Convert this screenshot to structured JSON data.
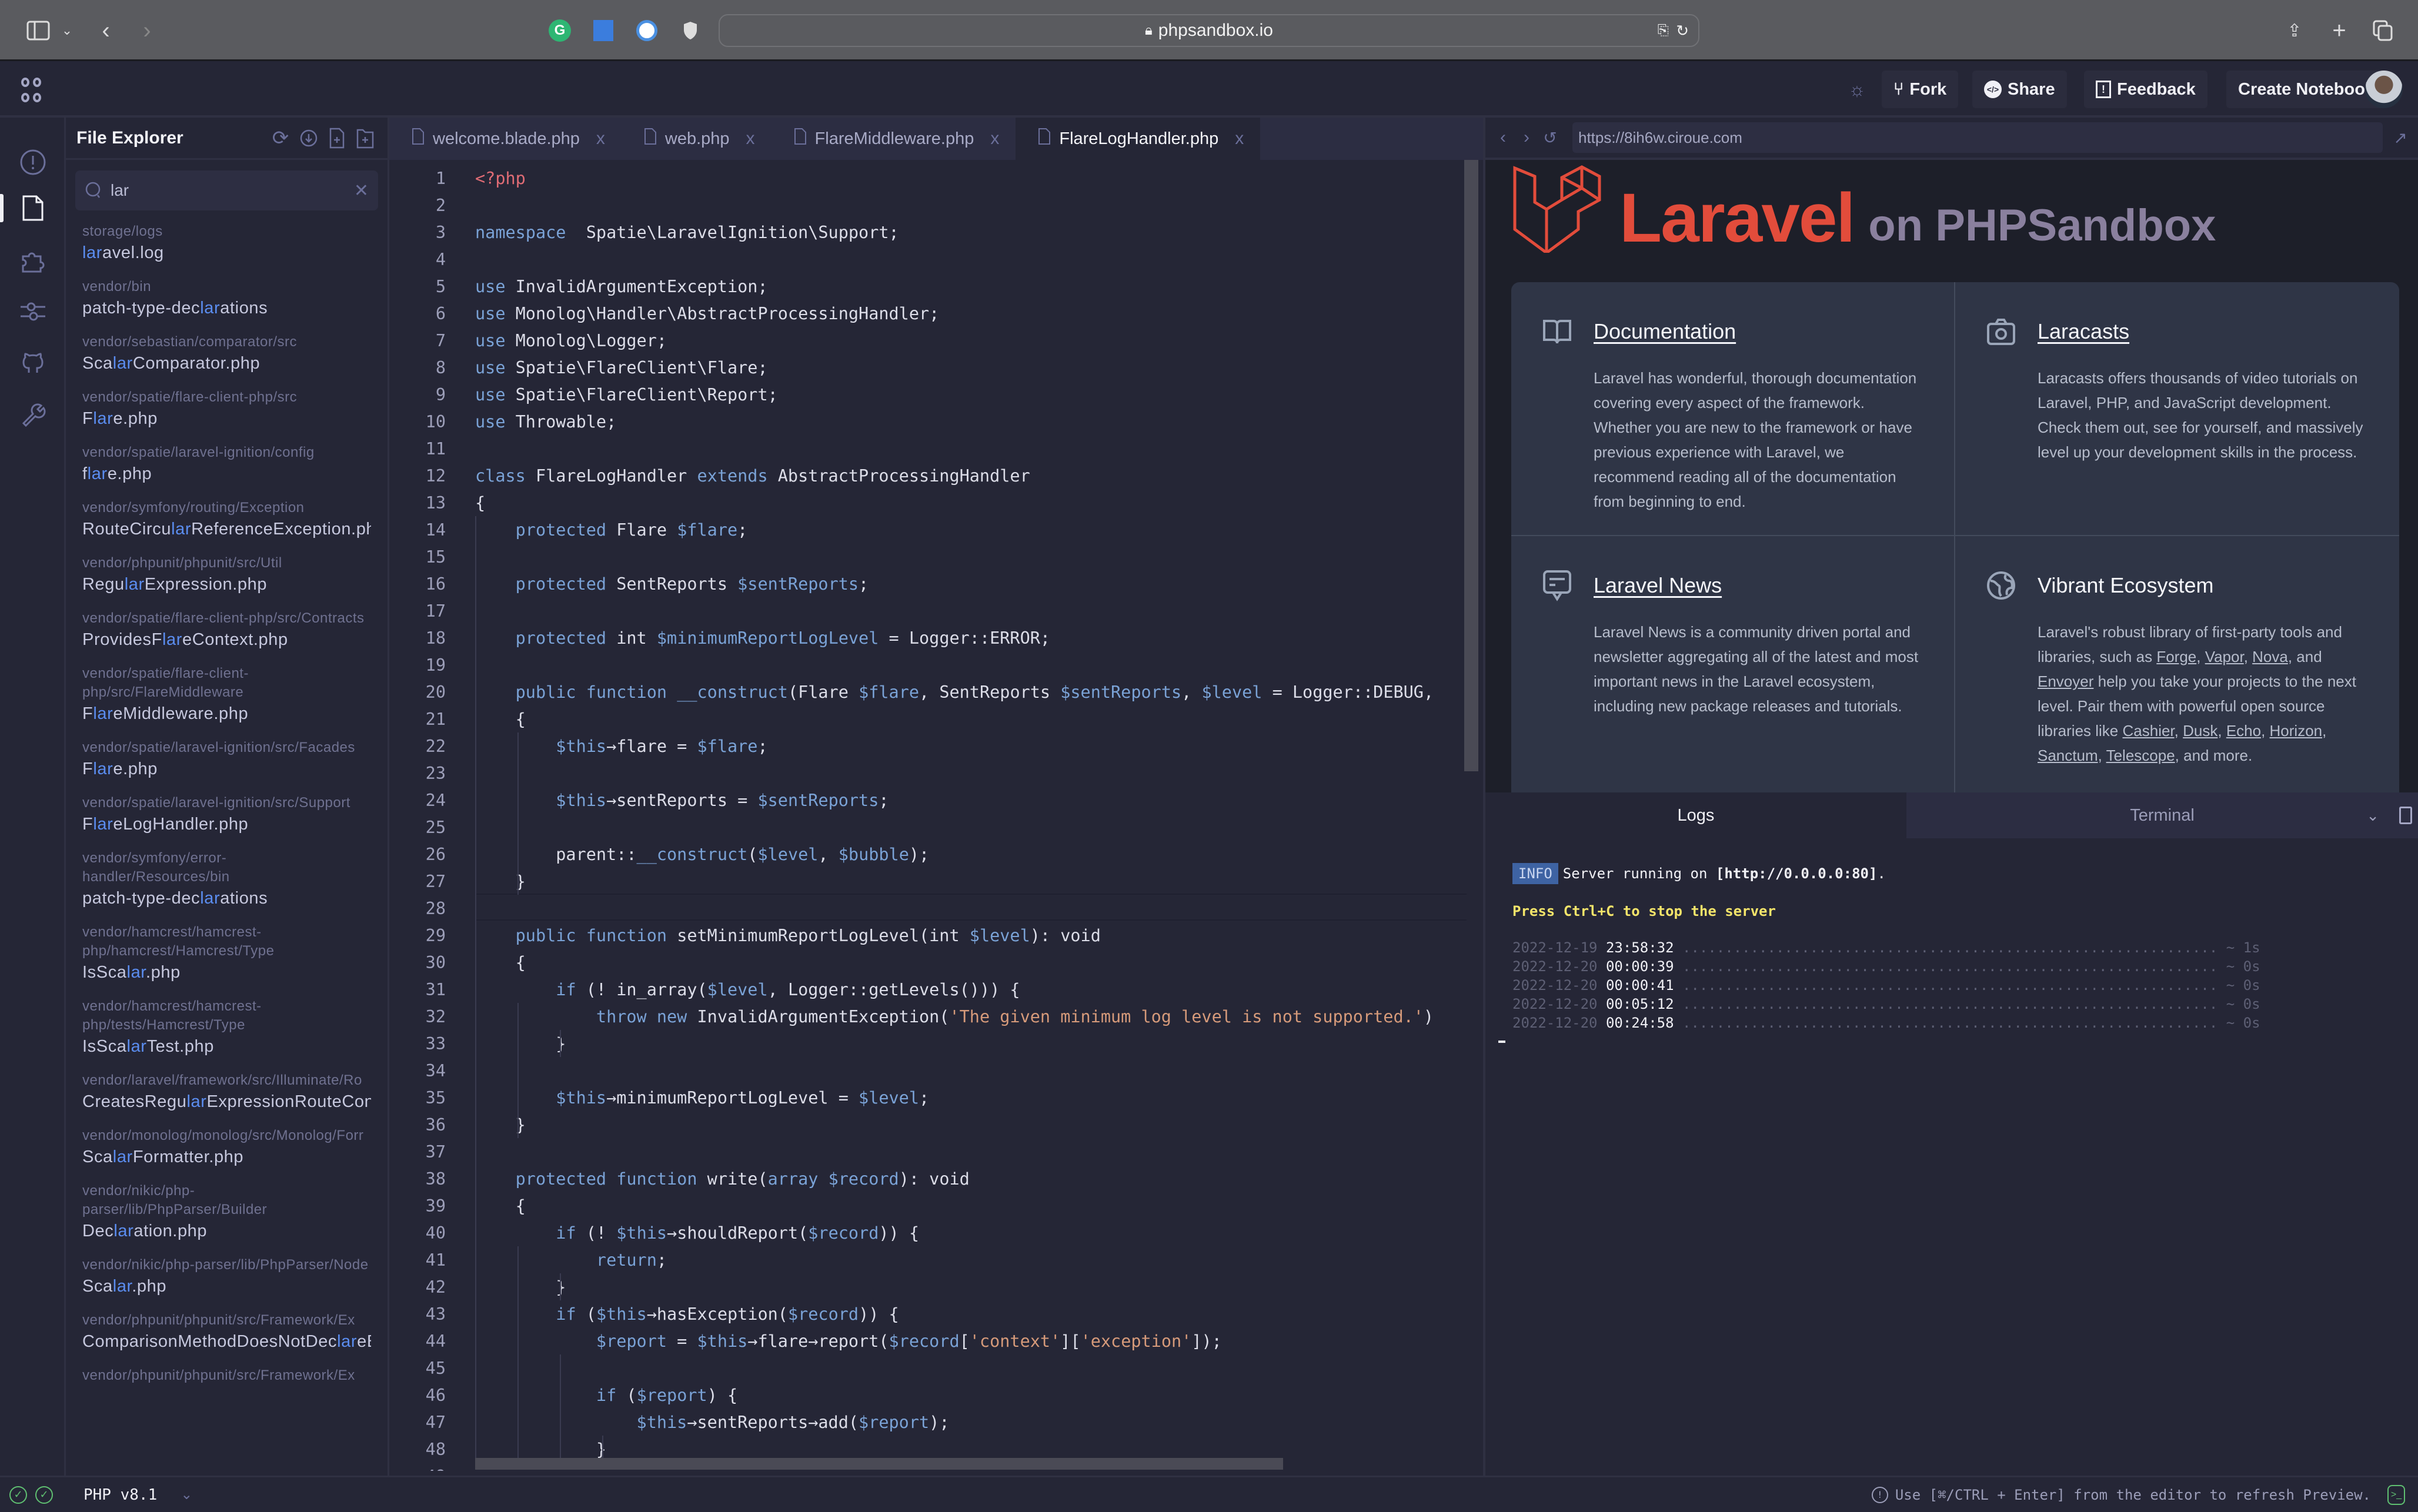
{
  "browser": {
    "url": "phpsandbox.io",
    "extensions": [
      "grammarly-icon",
      "reader-icon",
      "password-icon",
      "shield-icon"
    ]
  },
  "header": {
    "fork_label": "Fork",
    "share_label": "Share",
    "feedback_label": "Feedback",
    "create_notebook_label": "Create Notebook"
  },
  "explorer": {
    "title": "File Explorer",
    "search_value": "lar",
    "search_highlight": "lar",
    "files": [
      {
        "path": "storage/logs",
        "name": [
          "",
          "lar",
          "avel.log"
        ]
      },
      {
        "path": "vendor/bin",
        "name": [
          "patch-type-dec",
          "lar",
          "ations"
        ]
      },
      {
        "path": "vendor/sebastian/comparator/src",
        "name": [
          "Sca",
          "lar",
          "Comparator.php"
        ]
      },
      {
        "path": "vendor/spatie/flare-client-php/src",
        "name": [
          "F",
          "lar",
          "e.php"
        ]
      },
      {
        "path": "vendor/spatie/laravel-ignition/config",
        "name": [
          "f",
          "lar",
          "e.php"
        ]
      },
      {
        "path": "vendor/symfony/routing/Exception",
        "name": [
          "RouteCircu",
          "lar",
          "ReferenceException.ph"
        ]
      },
      {
        "path": "vendor/phpunit/phpunit/src/Util",
        "name": [
          "Regu",
          "lar",
          "Expression.php"
        ]
      },
      {
        "path": "vendor/spatie/flare-client-php/src/Contracts",
        "name": [
          "ProvidesF",
          "lar",
          "eContext.php"
        ]
      },
      {
        "path": "vendor/spatie/flare-client-php/src/FlareMiddleware",
        "name": [
          "F",
          "lar",
          "eMiddleware.php"
        ]
      },
      {
        "path": "vendor/spatie/laravel-ignition/src/Facades",
        "name": [
          "F",
          "lar",
          "e.php"
        ]
      },
      {
        "path": "vendor/spatie/laravel-ignition/src/Support",
        "name": [
          "F",
          "lar",
          "eLogHandler.php"
        ]
      },
      {
        "path": "vendor/symfony/error-handler/Resources/bin",
        "name": [
          "patch-type-dec",
          "lar",
          "ations"
        ]
      },
      {
        "path": "vendor/hamcrest/hamcrest-php/hamcrest/Hamcrest/Type",
        "name": [
          "IsSca",
          "lar",
          ".php"
        ]
      },
      {
        "path": "vendor/hamcrest/hamcrest-php/tests/Hamcrest/Type",
        "name": [
          "IsSca",
          "lar",
          "Test.php"
        ]
      },
      {
        "path": "vendor/laravel/framework/src/Illuminate/Ro",
        "name": [
          "CreatesRegu",
          "lar",
          "ExpressionRouteCons"
        ]
      },
      {
        "path": "vendor/monolog/monolog/src/Monolog/Forr",
        "name": [
          "Sca",
          "lar",
          "Formatter.php"
        ]
      },
      {
        "path": "vendor/nikic/php-parser/lib/PhpParser/Builder",
        "name": [
          "Dec",
          "lar",
          "ation.php"
        ]
      },
      {
        "path": "vendor/nikic/php-parser/lib/PhpParser/Node",
        "name": [
          "Sca",
          "lar",
          ".php"
        ]
      },
      {
        "path": "vendor/phpunit/phpunit/src/Framework/Ex",
        "name": [
          "ComparisonMethodDoesNotDec",
          "lar",
          "eB"
        ]
      },
      {
        "path": "vendor/phpunit/phpunit/src/Framework/Ex",
        "name": [
          "",
          "",
          ""
        ]
      }
    ]
  },
  "editor": {
    "tabs": [
      {
        "label": "welcome.blade.php",
        "active": false
      },
      {
        "label": "web.php",
        "active": false
      },
      {
        "label": "FlareMiddleware.php",
        "active": false
      },
      {
        "label": "FlareLogHandler.php",
        "active": true
      }
    ],
    "lines": [
      [
        [
          "tag",
          "<?php"
        ]
      ],
      [],
      [
        [
          "kw",
          "namespace"
        ],
        [
          "",
          "  Spatie\\LaravelIgnition\\Support;"
        ]
      ],
      [],
      [
        [
          "kw",
          "use"
        ],
        [
          "",
          " InvalidArgumentException;"
        ]
      ],
      [
        [
          "kw",
          "use"
        ],
        [
          "",
          " Monolog\\Handler\\AbstractProcessingHandler;"
        ]
      ],
      [
        [
          "kw",
          "use"
        ],
        [
          "",
          " Monolog\\Logger;"
        ]
      ],
      [
        [
          "kw",
          "use"
        ],
        [
          "",
          " Spatie\\FlareClient\\Flare;"
        ]
      ],
      [
        [
          "kw",
          "use"
        ],
        [
          "",
          " Spatie\\FlareClient\\Report;"
        ]
      ],
      [
        [
          "kw",
          "use"
        ],
        [
          "",
          " Throwable;"
        ]
      ],
      [],
      [
        [
          "kw",
          "class"
        ],
        [
          "",
          " FlareLogHandler "
        ],
        [
          "kw",
          "extends"
        ],
        [
          "",
          " AbstractProcessingHandler"
        ]
      ],
      [
        [
          "",
          "{"
        ]
      ],
      [
        [
          "",
          "    "
        ],
        [
          "kw",
          "protected"
        ],
        [
          "",
          " Flare "
        ],
        [
          "var",
          "$flare"
        ],
        [
          "",
          ";"
        ]
      ],
      [],
      [
        [
          "",
          "    "
        ],
        [
          "kw",
          "protected"
        ],
        [
          "",
          " SentReports "
        ],
        [
          "var",
          "$sentReports"
        ],
        [
          "",
          ";"
        ]
      ],
      [],
      [
        [
          "",
          "    "
        ],
        [
          "kw",
          "protected"
        ],
        [
          "",
          " int "
        ],
        [
          "var",
          "$minimumReportLogLevel"
        ],
        [
          "",
          " = Logger::ERROR;"
        ]
      ],
      [],
      [
        [
          "",
          "    "
        ],
        [
          "kw",
          "public function"
        ],
        [
          "",
          " "
        ],
        [
          "kw",
          "__construct"
        ],
        [
          "",
          "(Flare "
        ],
        [
          "var",
          "$flare"
        ],
        [
          "",
          ", SentReports "
        ],
        [
          "var",
          "$sentReports"
        ],
        [
          "",
          ", "
        ],
        [
          "var",
          "$level"
        ],
        [
          "",
          " = Logger::DEBUG,"
        ]
      ],
      [
        [
          "",
          "    {"
        ]
      ],
      [
        [
          "",
          "        "
        ],
        [
          "var",
          "$this"
        ],
        [
          "",
          "→flare = "
        ],
        [
          "var",
          "$flare"
        ],
        [
          "",
          ";"
        ]
      ],
      [],
      [
        [
          "",
          "        "
        ],
        [
          "var",
          "$this"
        ],
        [
          "",
          "→sentReports = "
        ],
        [
          "var",
          "$sentReports"
        ],
        [
          "",
          ";"
        ]
      ],
      [],
      [
        [
          "",
          "        parent::"
        ],
        [
          "kw",
          "__construct"
        ],
        [
          "",
          "("
        ],
        [
          "var",
          "$level"
        ],
        [
          "",
          ", "
        ],
        [
          "var",
          "$bubble"
        ],
        [
          "",
          ");"
        ]
      ],
      [
        [
          "",
          "    }"
        ]
      ],
      [],
      [
        [
          "",
          "    "
        ],
        [
          "kw",
          "public function"
        ],
        [
          "",
          " setMinimumReportLogLevel(int "
        ],
        [
          "var",
          "$level"
        ],
        [
          "",
          "): void"
        ]
      ],
      [
        [
          "",
          "    {"
        ]
      ],
      [
        [
          "",
          "        "
        ],
        [
          "kw",
          "if"
        ],
        [
          "",
          " (! in_array("
        ],
        [
          "var",
          "$level"
        ],
        [
          "",
          ", Logger::getLevels())) {"
        ]
      ],
      [
        [
          "",
          "            "
        ],
        [
          "kw",
          "throw new"
        ],
        [
          "",
          " InvalidArgumentException("
        ],
        [
          "str",
          "'The given minimum log level is not supported.'"
        ],
        [
          "",
          ")"
        ]
      ],
      [
        [
          "",
          "        }"
        ]
      ],
      [],
      [
        [
          "",
          "        "
        ],
        [
          "var",
          "$this"
        ],
        [
          "",
          "→minimumReportLogLevel = "
        ],
        [
          "var",
          "$level"
        ],
        [
          "",
          ";"
        ]
      ],
      [
        [
          "",
          "    }"
        ]
      ],
      [],
      [
        [
          "",
          "    "
        ],
        [
          "kw",
          "protected function"
        ],
        [
          "",
          " write("
        ],
        [
          "kw",
          "array"
        ],
        [
          "",
          " "
        ],
        [
          "var",
          "$record"
        ],
        [
          "",
          "): void"
        ]
      ],
      [
        [
          "",
          "    {"
        ]
      ],
      [
        [
          "",
          "        "
        ],
        [
          "kw",
          "if"
        ],
        [
          "",
          " (! "
        ],
        [
          "var",
          "$this"
        ],
        [
          "",
          "→shouldReport("
        ],
        [
          "var",
          "$record"
        ],
        [
          "",
          ")) {"
        ]
      ],
      [
        [
          "",
          "            "
        ],
        [
          "kw",
          "return"
        ],
        [
          "",
          ";"
        ]
      ],
      [
        [
          "",
          "        }"
        ]
      ],
      [
        [
          "",
          "        "
        ],
        [
          "kw",
          "if"
        ],
        [
          "",
          " ("
        ],
        [
          "var",
          "$this"
        ],
        [
          "",
          "→hasException("
        ],
        [
          "var",
          "$record"
        ],
        [
          "",
          ")) {"
        ]
      ],
      [
        [
          "",
          "            "
        ],
        [
          "var",
          "$report"
        ],
        [
          "",
          " = "
        ],
        [
          "var",
          "$this"
        ],
        [
          "",
          "→flare→report("
        ],
        [
          "var",
          "$record"
        ],
        [
          "",
          "["
        ],
        [
          "str",
          "'context'"
        ],
        [
          "",
          "]["
        ],
        [
          "str",
          "'exception'"
        ],
        [
          "",
          "]);"
        ]
      ],
      [],
      [
        [
          "",
          "            "
        ],
        [
          "kw",
          "if"
        ],
        [
          "",
          " ("
        ],
        [
          "var",
          "$report"
        ],
        [
          "",
          ") {"
        ]
      ],
      [
        [
          "",
          "                "
        ],
        [
          "var",
          "$this"
        ],
        [
          "",
          "→sentReports→add("
        ],
        [
          "var",
          "$report"
        ],
        [
          "",
          ");"
        ]
      ],
      [
        [
          "",
          "            }"
        ]
      ],
      []
    ]
  },
  "preview": {
    "url": "https://8ih6w.ciroue.com",
    "logo_word": "Laravel",
    "logo_suffix": "on PHPSandbox",
    "cards": [
      {
        "title": "Documentation",
        "icon": "book-icon",
        "link": true,
        "body": "Laravel has wonderful, thorough documentation covering every aspect of the framework. Whether you are new to the framework or have previous experience with Laravel, we recommend reading all of the documentation from beginning to end."
      },
      {
        "title": "Laracasts",
        "icon": "camera-icon",
        "link": true,
        "body": "Laracasts offers thousands of video tutorials on Laravel, PHP, and JavaScript development. Check them out, see for yourself, and massively level up your development skills in the process."
      },
      {
        "title": "Laravel News",
        "icon": "news-icon",
        "link": true,
        "body": "Laravel News is a community driven portal and newsletter aggregating all of the latest and most important news in the Laravel ecosystem, including new package releases and tutorials."
      },
      {
        "title": "Vibrant Ecosystem",
        "icon": "globe-icon",
        "link": false,
        "body_parts": [
          {
            "t": "Laravel's robust library of first-party tools and libraries, such as "
          },
          {
            "t": "Forge",
            "link": true
          },
          {
            "t": ", "
          },
          {
            "t": "Vapor",
            "link": true
          },
          {
            "t": ", "
          },
          {
            "t": "Nova",
            "link": true
          },
          {
            "t": ", and "
          },
          {
            "t": "Envoyer",
            "link": true
          },
          {
            "t": " help you take your projects to the next level. Pair them with powerful open source libraries like "
          },
          {
            "t": "Cashier",
            "link": true
          },
          {
            "t": ", "
          },
          {
            "t": "Dusk",
            "link": true
          },
          {
            "t": ", "
          },
          {
            "t": "Echo",
            "link": true
          },
          {
            "t": ", "
          },
          {
            "t": "Horizon",
            "link": true
          },
          {
            "t": ", "
          },
          {
            "t": "Sanctum",
            "link": true
          },
          {
            "t": ", "
          },
          {
            "t": "Telescope",
            "link": true
          },
          {
            "t": ", and more."
          }
        ]
      }
    ]
  },
  "console": {
    "tabs": {
      "logs": "Logs",
      "terminal": "Terminal"
    },
    "info_badge": "INFO",
    "server_text": "Server running on ",
    "server_url": "[http://0.0.0.0:80]",
    "stop_hint": "Press Ctrl+C to stop the server",
    "entries": [
      {
        "date": "2022-12-19",
        "time": "23:58:32",
        "duration": "~ 1s"
      },
      {
        "date": "2022-12-20",
        "time": "00:00:39",
        "duration": "~ 0s"
      },
      {
        "date": "2022-12-20",
        "time": "00:00:41",
        "duration": "~ 0s"
      },
      {
        "date": "2022-12-20",
        "time": "00:05:12",
        "duration": "~ 0s"
      },
      {
        "date": "2022-12-20",
        "time": "00:24:58",
        "duration": "~ 0s"
      }
    ]
  },
  "status": {
    "php_version": "PHP v8.1",
    "hint": "Use [⌘/CTRL + Enter] from the editor to refresh Preview."
  }
}
